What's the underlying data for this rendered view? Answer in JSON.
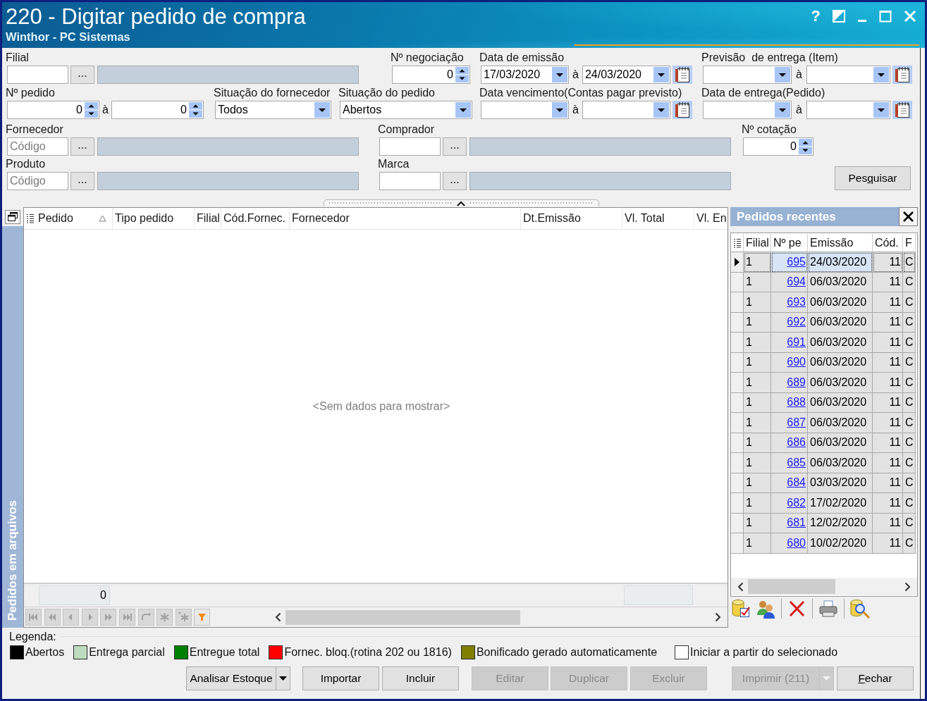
{
  "window": {
    "title": "220 - Digitar pedido de compra",
    "subtitle": "Winthor - PC Sistemas",
    "help_label": "?"
  },
  "filter_rows": [
    [
      {
        "kind": "lookup",
        "label": "Filial",
        "button": "..."
      },
      {
        "kind": "spin",
        "label": "Nº negociação",
        "value": "0"
      },
      {
        "kind": "date_range",
        "label": "Data de emissão",
        "from": "17/03/2020",
        "separator": "à",
        "to": "24/03/2020"
      },
      {
        "kind": "date_range",
        "label": "Previsão  de entrega (Item)",
        "separator": "à"
      }
    ],
    [
      {
        "kind": "spin_range",
        "label": "Nº pedido",
        "from": "0",
        "separator": "à",
        "to": "0"
      },
      {
        "kind": "combo",
        "label": "Situação do fornecedor",
        "value": "Todos"
      },
      {
        "kind": "combo",
        "label": "Situação do pedido",
        "value": "Abertos"
      },
      {
        "kind": "date_range",
        "label": "Data vencimento(Contas pagar previsto)",
        "separator": "à"
      },
      {
        "kind": "date_range",
        "label": "Data de entrega(Pedido)",
        "separator": "à"
      }
    ],
    [
      {
        "kind": "lookup",
        "label": "Fornecedor",
        "placeholder": "Código",
        "button": "..."
      },
      {
        "kind": "lookup",
        "label": "Comprador",
        "button": "..."
      },
      {
        "kind": "spin",
        "label": "Nº cotação",
        "value": "0"
      }
    ],
    [
      {
        "kind": "lookup",
        "label": "Produto",
        "placeholder": "Código",
        "button": "..."
      },
      {
        "kind": "lookup",
        "label": "Marca",
        "button": "..."
      },
      {
        "kind": "button",
        "label": "Pesquisar"
      }
    ]
  ],
  "side_tab": {
    "label": "Pedidos em arquivos"
  },
  "orders_grid": {
    "columns": [
      {
        "label": "Pedido",
        "sorted": true
      },
      {
        "label": "Tipo pedido",
        "sorted": false
      },
      {
        "label": "Filial",
        "sorted": false
      },
      {
        "label": "Cód.Fornec.",
        "sorted": false
      },
      {
        "label": "Fornecedor",
        "sorted": false
      },
      {
        "label": "Dt.Emissão",
        "sorted": false
      },
      {
        "label": "Vl. Total",
        "sorted": false
      },
      {
        "label": "Vl. En",
        "sorted": false
      }
    ],
    "empty_text": "<Sem dados para mostrar>",
    "summary": "0"
  },
  "recent_orders": {
    "title": "Pedidos recentes",
    "columns": [
      "Filial",
      "Nº pe",
      "Emissão",
      "Cód.",
      "F"
    ],
    "rows": [
      {
        "cells": [
          "1",
          "695",
          "24/03/2020",
          "11",
          "C"
        ],
        "selected": true
      },
      {
        "cells": [
          "1",
          "694",
          "06/03/2020",
          "11",
          "C"
        ],
        "selected": false
      },
      {
        "cells": [
          "1",
          "693",
          "06/03/2020",
          "11",
          "C"
        ],
        "selected": false
      },
      {
        "cells": [
          "1",
          "692",
          "06/03/2020",
          "11",
          "C"
        ],
        "selected": false
      },
      {
        "cells": [
          "1",
          "691",
          "06/03/2020",
          "11",
          "C"
        ],
        "selected": false
      },
      {
        "cells": [
          "1",
          "690",
          "06/03/2020",
          "11",
          "C"
        ],
        "selected": false
      },
      {
        "cells": [
          "1",
          "689",
          "06/03/2020",
          "11",
          "C"
        ],
        "selected": false
      },
      {
        "cells": [
          "1",
          "688",
          "06/03/2020",
          "11",
          "C"
        ],
        "selected": false
      },
      {
        "cells": [
          "1",
          "687",
          "06/03/2020",
          "11",
          "C"
        ],
        "selected": false
      },
      {
        "cells": [
          "1",
          "686",
          "06/03/2020",
          "11",
          "C"
        ],
        "selected": false
      },
      {
        "cells": [
          "1",
          "685",
          "06/03/2020",
          "11",
          "C"
        ],
        "selected": false
      },
      {
        "cells": [
          "1",
          "684",
          "03/03/2020",
          "11",
          "C"
        ],
        "selected": false
      },
      {
        "cells": [
          "1",
          "682",
          "17/02/2020",
          "11",
          "C"
        ],
        "selected": false
      },
      {
        "cells": [
          "1",
          "681",
          "12/02/2020",
          "11",
          "C"
        ],
        "selected": false
      },
      {
        "cells": [
          "1",
          "680",
          "10/02/2020",
          "11",
          "C"
        ],
        "selected": false
      }
    ]
  },
  "legend": {
    "title": "Legenda:",
    "items": [
      {
        "label": "Abertos",
        "color": "#000000"
      },
      {
        "label": "Entrega parcial",
        "color": "#c0dcc0"
      },
      {
        "label": "Entregue total",
        "color": "#008000"
      },
      {
        "label": "Fornec. bloq.(rotina 202 ou 1816)",
        "color": "#ff0000"
      },
      {
        "label": "Bonificado gerado automaticamente",
        "color": "#808000"
      }
    ]
  },
  "start_from_selected": {
    "label": "Iniciar a partir do selecionado",
    "checked": false
  },
  "buttons": [
    {
      "label": "Analisar Estoque",
      "disabled": false,
      "dropdown": true
    },
    {
      "label": "Importar",
      "disabled": false,
      "dropdown": false
    },
    {
      "label": "Incluir",
      "disabled": false,
      "dropdown": false
    },
    {
      "label": "Editar",
      "disabled": true,
      "dropdown": false
    },
    {
      "label": "Duplicar",
      "disabled": true,
      "dropdown": false
    },
    {
      "label": "Excluir",
      "disabled": true,
      "dropdown": false
    },
    {
      "label": "Imprimir (211)",
      "disabled": true,
      "dropdown": true
    },
    {
      "label": "Fechar",
      "disabled": false,
      "dropdown": false
    }
  ]
}
